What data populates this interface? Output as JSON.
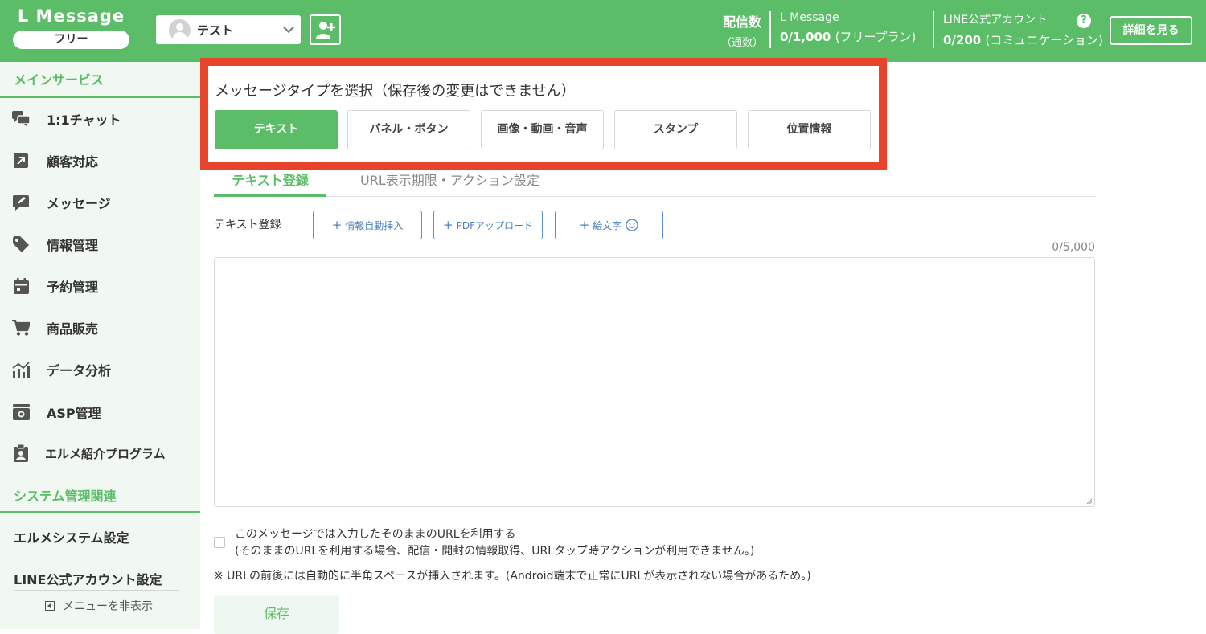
{
  "header": {
    "brand": "L Message",
    "plan": "フリー",
    "account_name": "テスト",
    "stats_title": "配信数",
    "stats_sub": "（通数）",
    "lmessage_label": "L Message",
    "lmessage_value": "0/1,000",
    "lmessage_plan": "(フリープラン)",
    "line_label": "LINE公式アカウント",
    "line_value": "0/200",
    "line_plan": "(コミュニケーション)",
    "help": "?",
    "detail_button": "詳細を見る",
    "colors": {
      "primary": "#5bbd67",
      "highlight": "#e8432b"
    }
  },
  "sidebar": {
    "section_main": "メインサービス",
    "items": [
      {
        "label": "1:1チャット",
        "icon": "chat-icon"
      },
      {
        "label": "顧客対応",
        "icon": "arrow-up-right-icon"
      },
      {
        "label": "メッセージ",
        "icon": "edit-message-icon"
      },
      {
        "label": "情報管理",
        "icon": "tag-icon"
      },
      {
        "label": "予約管理",
        "icon": "calendar-icon"
      },
      {
        "label": "商品販売",
        "icon": "cart-icon"
      },
      {
        "label": "データ分析",
        "icon": "chart-icon"
      },
      {
        "label": "ASP管理",
        "icon": "register-icon"
      },
      {
        "label": "エルメ紹介プログラム",
        "icon": "badge-icon"
      }
    ],
    "section_system": "システム管理関連",
    "system_settings": "エルメシステム設定",
    "line_settings": "LINE公式アカウント設定",
    "hide_menu": "メニューを非表示"
  },
  "main": {
    "type_title": "メッセージタイプを選択（保存後の変更はできません）",
    "types": [
      "テキスト",
      "パネル・ボタン",
      "画像・動画・音声",
      "スタンプ",
      "位置情報"
    ],
    "tabs": [
      "テキスト登録",
      "URL表示期限・アクション設定"
    ],
    "text_label": "テキスト登録",
    "tool_info": "情報自動挿入",
    "tool_pdf": "PDFアップロード",
    "tool_emoji": "絵文字",
    "char_count": "0/5,000",
    "url_option": "このメッセージでは入力したそのままのURLを利用する",
    "url_option_note": "(そのままのURLを利用する場合、配信・開封の情報取得、URLタップ時アクションが利用できません。)",
    "note": "※ URLの前後には自動的に半角スペースが挿入されます。(Android端末で正常にURLが表示されない場合があるため。)",
    "save": "保存"
  }
}
